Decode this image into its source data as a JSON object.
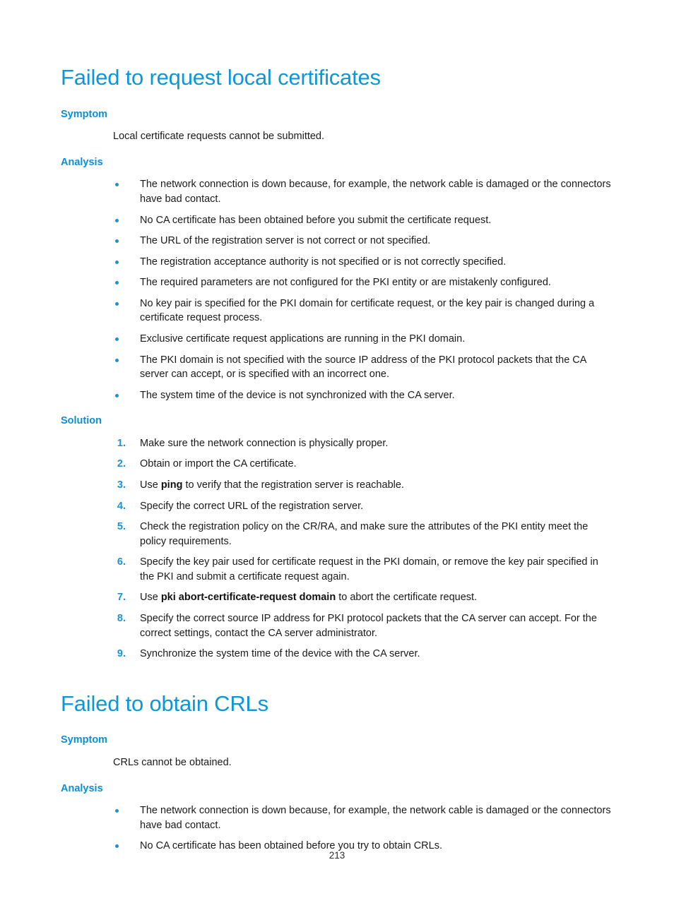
{
  "page": {
    "number": "213"
  },
  "sections": [
    {
      "title": "Failed to request local certificates",
      "symptom_heading": "Symptom",
      "symptom_text": "Local certificate requests cannot be submitted.",
      "analysis_heading": "Analysis",
      "analysis_items": [
        "The network connection is down because, for example, the network cable is damaged or the connectors have bad contact.",
        "No CA certificate has been obtained before you submit the certificate request.",
        "The URL of the registration server is not correct or not specified.",
        "The registration acceptance authority is not specified or is not correctly specified.",
        "The required parameters are not configured for the PKI entity or are mistakenly configured.",
        "No key pair is specified for the PKI domain for certificate request, or the key pair is changed during a certificate request process.",
        "Exclusive certificate request applications are running in the PKI domain.",
        "The PKI domain is not specified with the source IP address of the PKI protocol packets that the CA server can accept, or is specified with an incorrect one.",
        "The system time of the device is not synchronized with the CA server."
      ],
      "solution_heading": "Solution",
      "solution_items": [
        {
          "number": "1.",
          "before": "Make sure the network connection is physically proper.",
          "bold": "",
          "after": ""
        },
        {
          "number": "2.",
          "before": "Obtain or import the CA certificate.",
          "bold": "",
          "after": ""
        },
        {
          "number": "3.",
          "before": "Use ",
          "bold": "ping",
          "after": " to verify that the registration server is reachable."
        },
        {
          "number": "4.",
          "before": "Specify the correct URL of the registration server.",
          "bold": "",
          "after": ""
        },
        {
          "number": "5.",
          "before": "Check the registration policy on the CR/RA, and make sure the attributes of the PKI entity meet the policy requirements.",
          "bold": "",
          "after": ""
        },
        {
          "number": "6.",
          "before": "Specify the key pair used for certificate request in the PKI domain, or remove the key pair specified in the PKI and submit a certificate request again.",
          "bold": "",
          "after": ""
        },
        {
          "number": "7.",
          "before": "Use ",
          "bold": "pki abort-certificate-request domain",
          "after": " to abort the certificate request."
        },
        {
          "number": "8.",
          "before": "Specify the correct source IP address for PKI protocol packets that the CA server can accept. For the correct settings, contact the CA server administrator.",
          "bold": "",
          "after": ""
        },
        {
          "number": "9.",
          "before": "Synchronize the system time of the device with the CA server.",
          "bold": "",
          "after": ""
        }
      ]
    },
    {
      "title": "Failed to obtain CRLs",
      "symptom_heading": "Symptom",
      "symptom_text": "CRLs cannot be obtained.",
      "analysis_heading": "Analysis",
      "analysis_items": [
        "The network connection is down because, for example, the network cable is damaged or the connectors have bad contact.",
        "No CA certificate has been obtained before you try to obtain CRLs."
      ]
    }
  ],
  "colors": {
    "heading_blue": "#0d97d6",
    "subheading_blue": "#0d8fd1",
    "marker_blue": "#1a93d4",
    "body_text": "#1a1a1a"
  }
}
